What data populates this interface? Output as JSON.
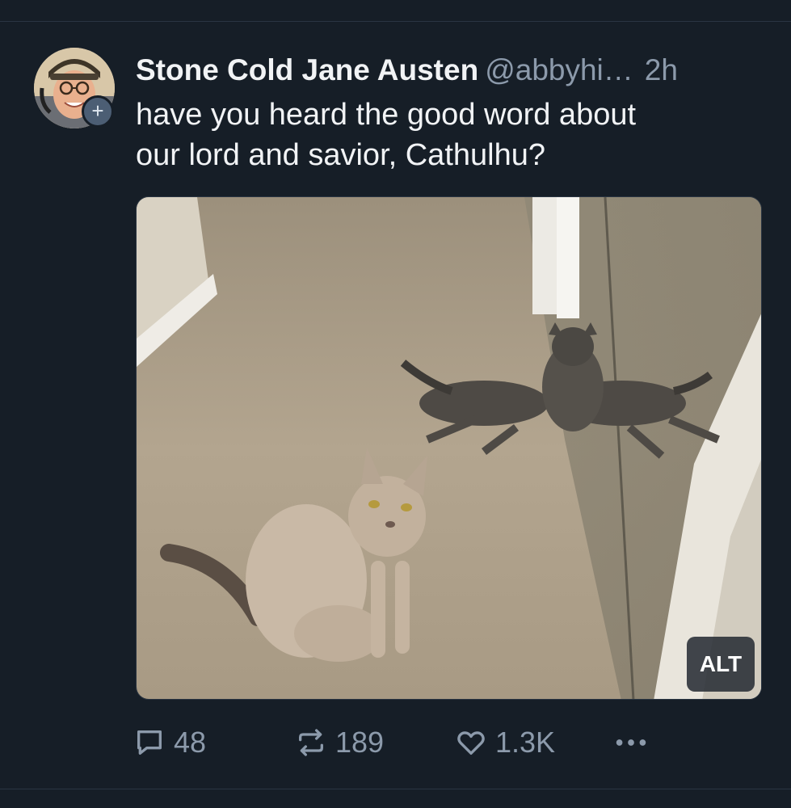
{
  "post": {
    "author": {
      "display_name": "Stone Cold Jane Austen",
      "handle": "@abbyhi…",
      "separator": "",
      "timestamp": "2h"
    },
    "text_line1": "have you heard the good word about",
    "text_line2": "our lord and savior, Cathulhu?",
    "media": {
      "alt_label": "ALT"
    },
    "actions": {
      "reply_count": "48",
      "repost_count": "189",
      "like_count": "1.3K",
      "more_icon": "ellipsis-icon"
    }
  },
  "colors": {
    "background": "#161e27",
    "text_primary": "#f1f3f5",
    "text_secondary": "#8c9aab",
    "follow_button": "#4c5e74"
  }
}
